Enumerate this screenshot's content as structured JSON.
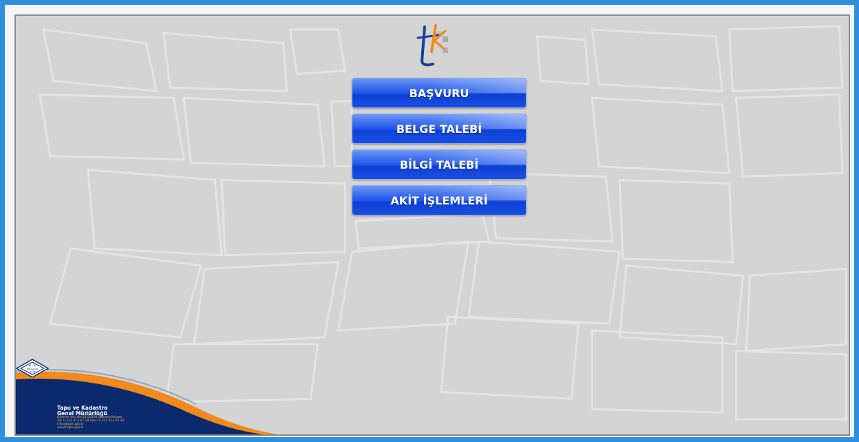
{
  "window": {
    "title": ""
  },
  "logo": {
    "icon": "tkgm-logo-icon",
    "letters": "tk"
  },
  "menu": {
    "items": [
      {
        "label": "BAŞVURU"
      },
      {
        "label": "BELGE TALEBİ"
      },
      {
        "label": "BİLGİ TALEBİ"
      },
      {
        "label": "AKİT İŞLEMLERİ"
      }
    ]
  },
  "footer": {
    "org_line1": "Tapu ve Kadastro",
    "org_line2": "Genel Müdürlüğü",
    "address": "Dikmen Yolu No:14 06100 Dikmen/Ankara",
    "phone": "Tel: 0 312 413 67 58 Faks: 0 312 413 67 92",
    "email": "info@tkgm.gov.tr",
    "website": "www.tkgm.gov.tr",
    "seal_text_top": "K · Ü",
    "seal_text_mid": "TSE-ISO-EN",
    "seal_text_bottom": "9000"
  },
  "colors": {
    "frame": "#2f8fe0",
    "panel": "#d4d4d4",
    "button": "#1f54e6",
    "footer_navy": "#0b2a6e",
    "footer_orange": "#f08a1c"
  }
}
